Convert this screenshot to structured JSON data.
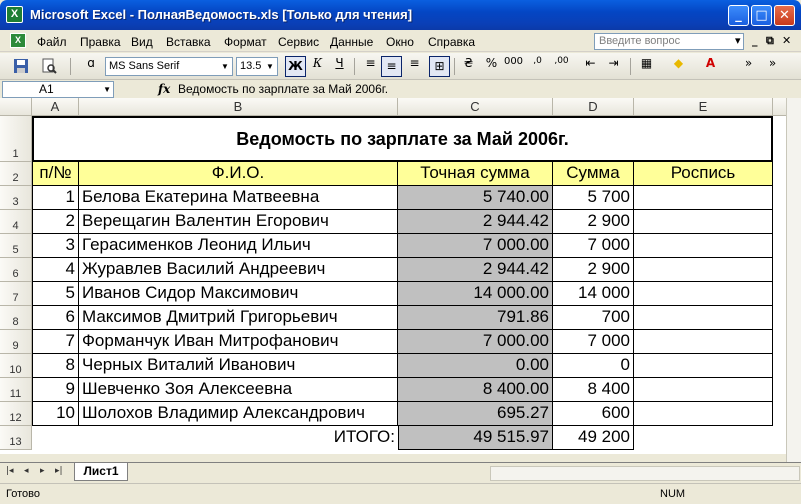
{
  "window": {
    "title": "Microsoft Excel - ПолнаяВедомость.xls  [Только для чтения]",
    "icon": "excel-icon",
    "buttons": [
      "_",
      "□",
      "✕"
    ]
  },
  "menu": {
    "items": [
      "Файл",
      "Правка",
      "Вид",
      "Вставка",
      "Формат",
      "Сервис",
      "Данные",
      "Окно",
      "Справка"
    ],
    "help_placeholder": "Введите вопрос",
    "mdi_buttons": [
      "▾",
      "_",
      "⧉",
      "✕"
    ]
  },
  "toolbar": {
    "font_name": "MS Sans Serif",
    "font_size": "13.5",
    "bold_label": "Ж",
    "italic_label": "К",
    "underline_label": "Ч",
    "percent_label": "%",
    "thousands_label": "000",
    "decimal_inc_label": ",0",
    "decimal_dec_label": ",00"
  },
  "formula_bar": {
    "cell_ref": "A1",
    "fx": "fx",
    "content": "Ведомость по зарплате за Май 2006г."
  },
  "sheet": {
    "columns": [
      "A",
      "B",
      "C",
      "D",
      "E"
    ],
    "row_numbers": [
      "1",
      "2",
      "3",
      "4",
      "5",
      "6",
      "7",
      "8",
      "9",
      "10",
      "11",
      "12",
      "13"
    ],
    "title": "Ведомость по зарплате за Май 2006г.",
    "headers": [
      "п/№",
      "Ф.И.О.",
      "Точная сумма",
      "Сумма",
      "Роспись"
    ],
    "rows": [
      [
        "1",
        "Белова Екатерина Матвеевна",
        "5 740.00",
        "5 700",
        ""
      ],
      [
        "2",
        "Верещагин Валентин Егорович",
        "2 944.42",
        "2 900",
        ""
      ],
      [
        "3",
        "Герасименков Леонид Ильич",
        "7 000.00",
        "7 000",
        ""
      ],
      [
        "4",
        "Журавлев Василий Андреевич",
        "2 944.42",
        "2 900",
        ""
      ],
      [
        "5",
        "Иванов Сидор Максимович",
        "14 000.00",
        "14 000",
        ""
      ],
      [
        "6",
        "Максимов Дмитрий Григорьевич",
        "791.86",
        "700",
        ""
      ],
      [
        "7",
        "Форманчук Иван Митрофанович",
        "7 000.00",
        "7 000",
        ""
      ],
      [
        "8",
        "Черных Виталий Иванович",
        "0.00",
        "0",
        ""
      ],
      [
        "9",
        "Шевченко Зоя Алексеевна",
        "8 400.00",
        "8 400",
        ""
      ],
      [
        "10",
        "Шолохов Владимир Александрович",
        "695.27",
        "600",
        ""
      ]
    ],
    "total_label": "ИТОГО:",
    "total_exact": "49 515.97",
    "total_rounded": "49 200"
  },
  "tabs": {
    "nav": [
      "|◂",
      "◂",
      "▸",
      "▸|"
    ],
    "sheets": [
      "Лист1"
    ]
  },
  "status": {
    "ready": "Готово",
    "num": "NUM"
  },
  "colors": {
    "header_fill": "#ffff99",
    "exact_sum_fill": "#c0c0c0",
    "titlebar": "#0a46c4"
  }
}
